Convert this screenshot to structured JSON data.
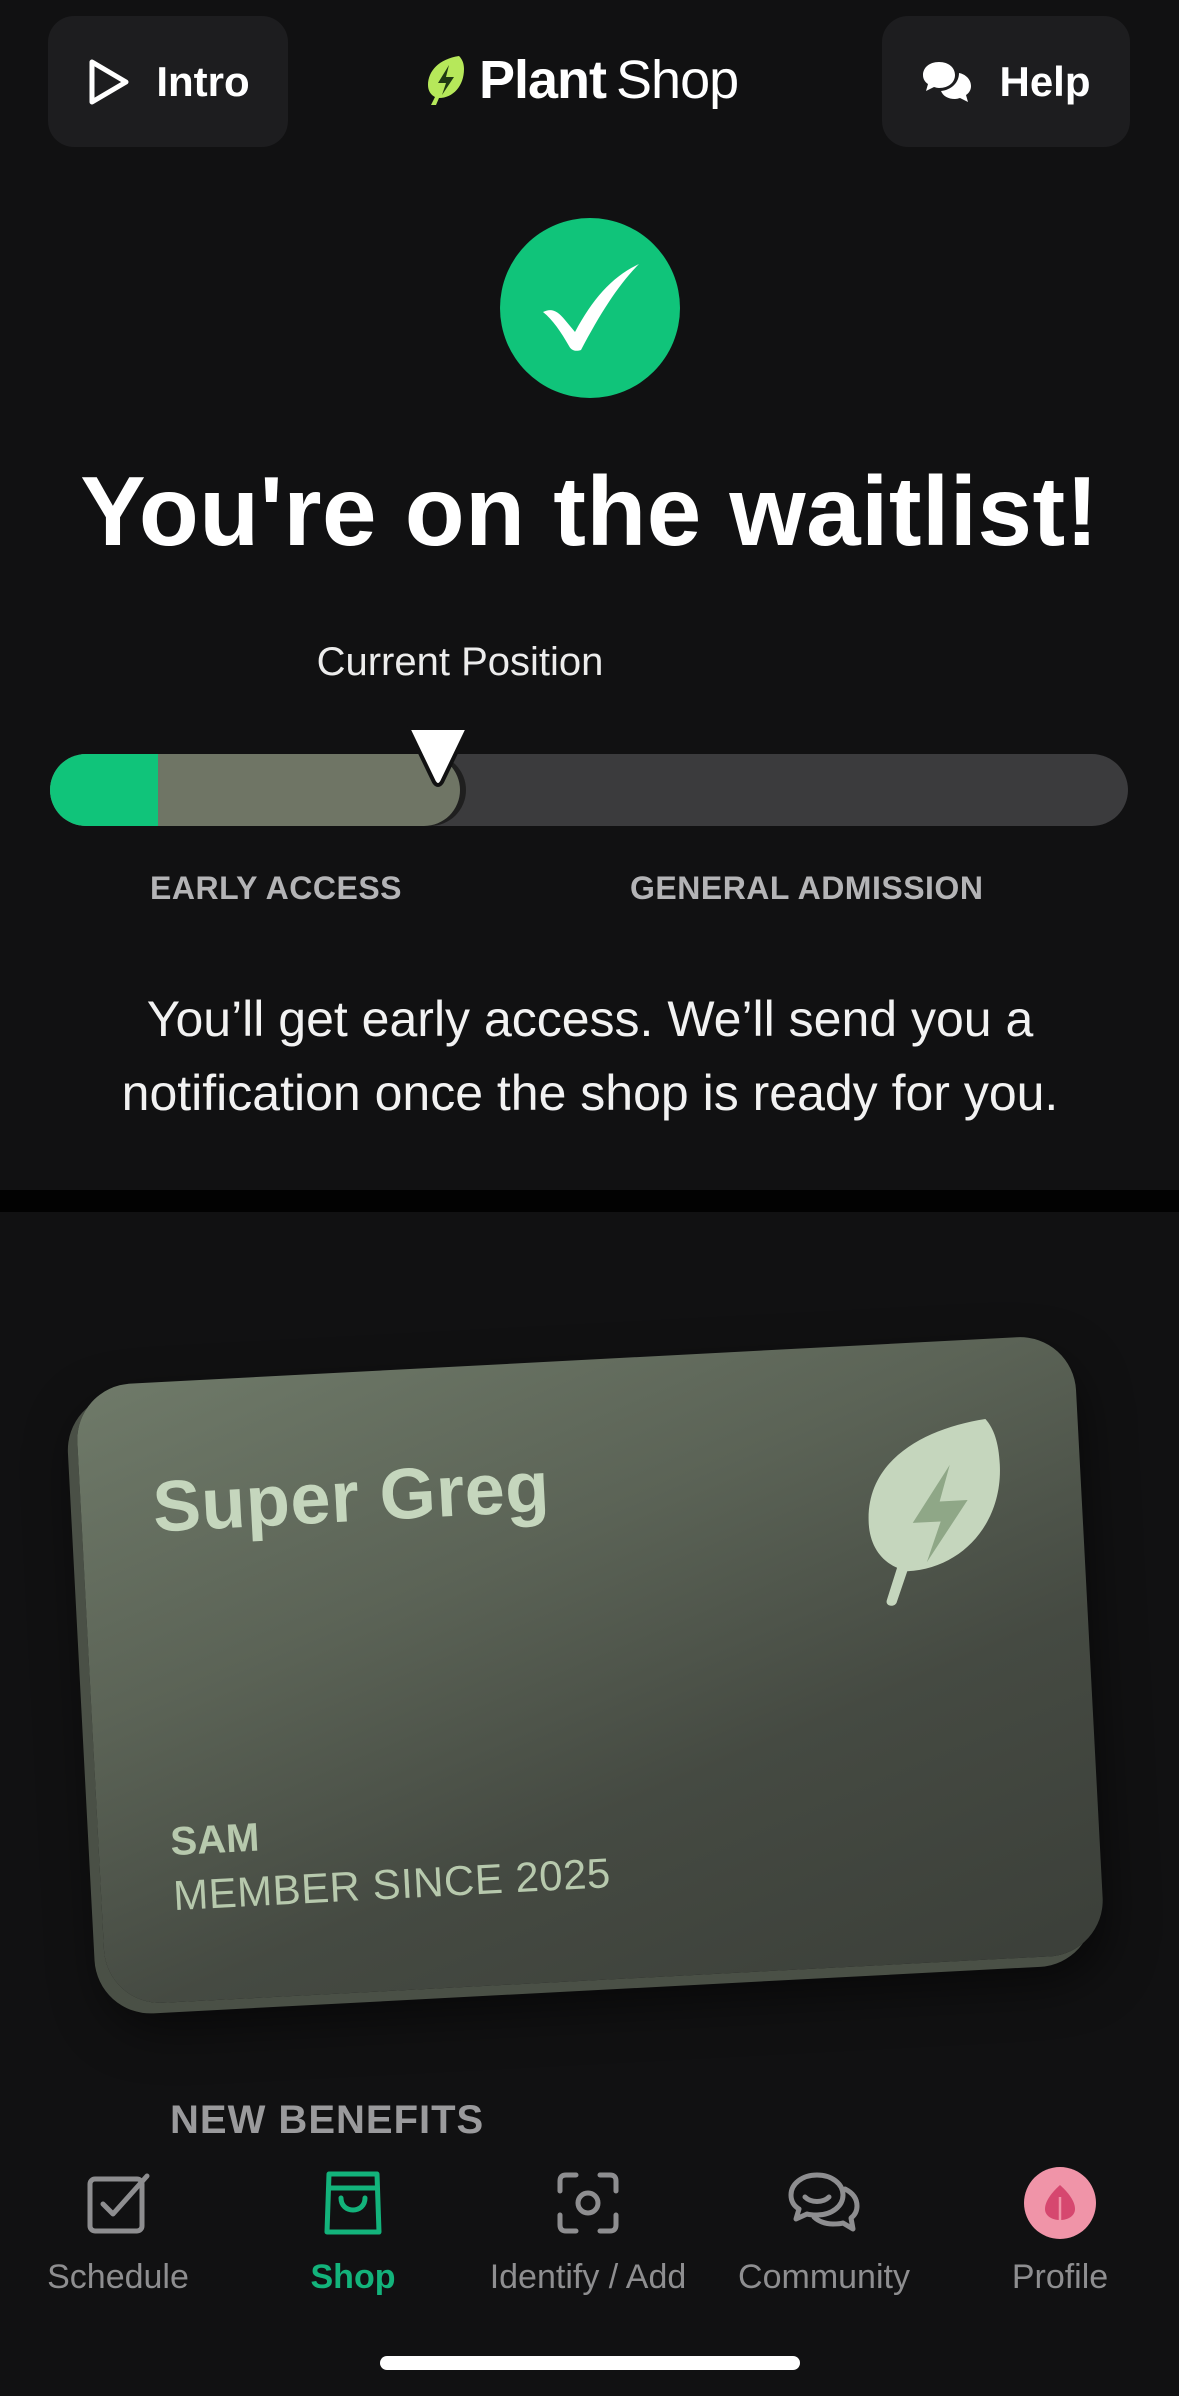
{
  "header": {
    "intro_label": "Intro",
    "help_label": "Help",
    "brand_bold": "Plant",
    "brand_regular": "Shop"
  },
  "status": {
    "title": "You're on the waitlist!",
    "current_position_label": "Current Position",
    "early_access_label": "EARLY ACCESS",
    "general_admission_label": "GENERAL ADMISSION",
    "description": "You’ll get early access. We’ll send you a notification once the shop is ready for you.",
    "position_fraction": 0.38,
    "early_segment_fraction": 0.1
  },
  "card": {
    "brand": "Super Greg",
    "member_name": "SAM",
    "member_since": "MEMBER SINCE 2025"
  },
  "benefits_heading": "NEW BENEFITS",
  "nav": {
    "items": [
      {
        "label": "Schedule",
        "icon": "checkbox-icon"
      },
      {
        "label": "Shop",
        "icon": "shopping-bag-icon",
        "active": true
      },
      {
        "label": "Identify / Add",
        "icon": "scan-icon"
      },
      {
        "label": "Community",
        "icon": "chat-bubbles-icon"
      },
      {
        "label": "Profile",
        "icon": "profile-avatar"
      }
    ]
  },
  "colors": {
    "accent": "#10c47a",
    "background": "#111112",
    "button_bg": "#1d1d1f",
    "card_text": "#c5d6bd",
    "avatar": "#f094a8"
  }
}
